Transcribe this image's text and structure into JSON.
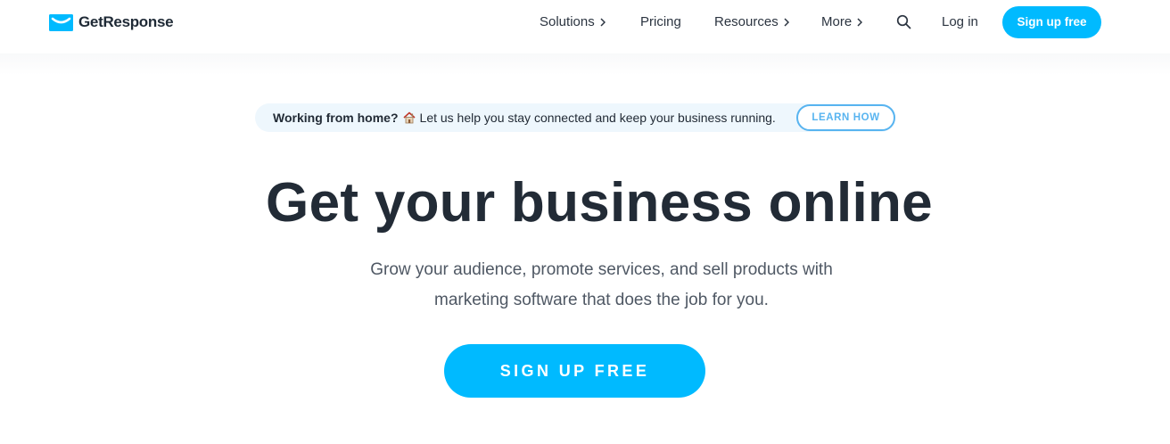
{
  "brand": {
    "name": "GetResponse",
    "color": "#00baff"
  },
  "nav": {
    "solutions": "Solutions",
    "pricing": "Pricing",
    "resources": "Resources",
    "more": "More",
    "login": "Log in",
    "signup": "Sign up free"
  },
  "notice": {
    "lead": "Working from home?",
    "icon": "house-icon",
    "message": "Let us help you stay connected and keep your business running.",
    "button": "LEARN HOW"
  },
  "hero": {
    "headline": "Get your business online",
    "subhead_line1": "Grow your audience, promote services, and sell products with",
    "subhead_line2": "marketing software that does the job for you.",
    "cta": "SIGN UP FREE"
  }
}
